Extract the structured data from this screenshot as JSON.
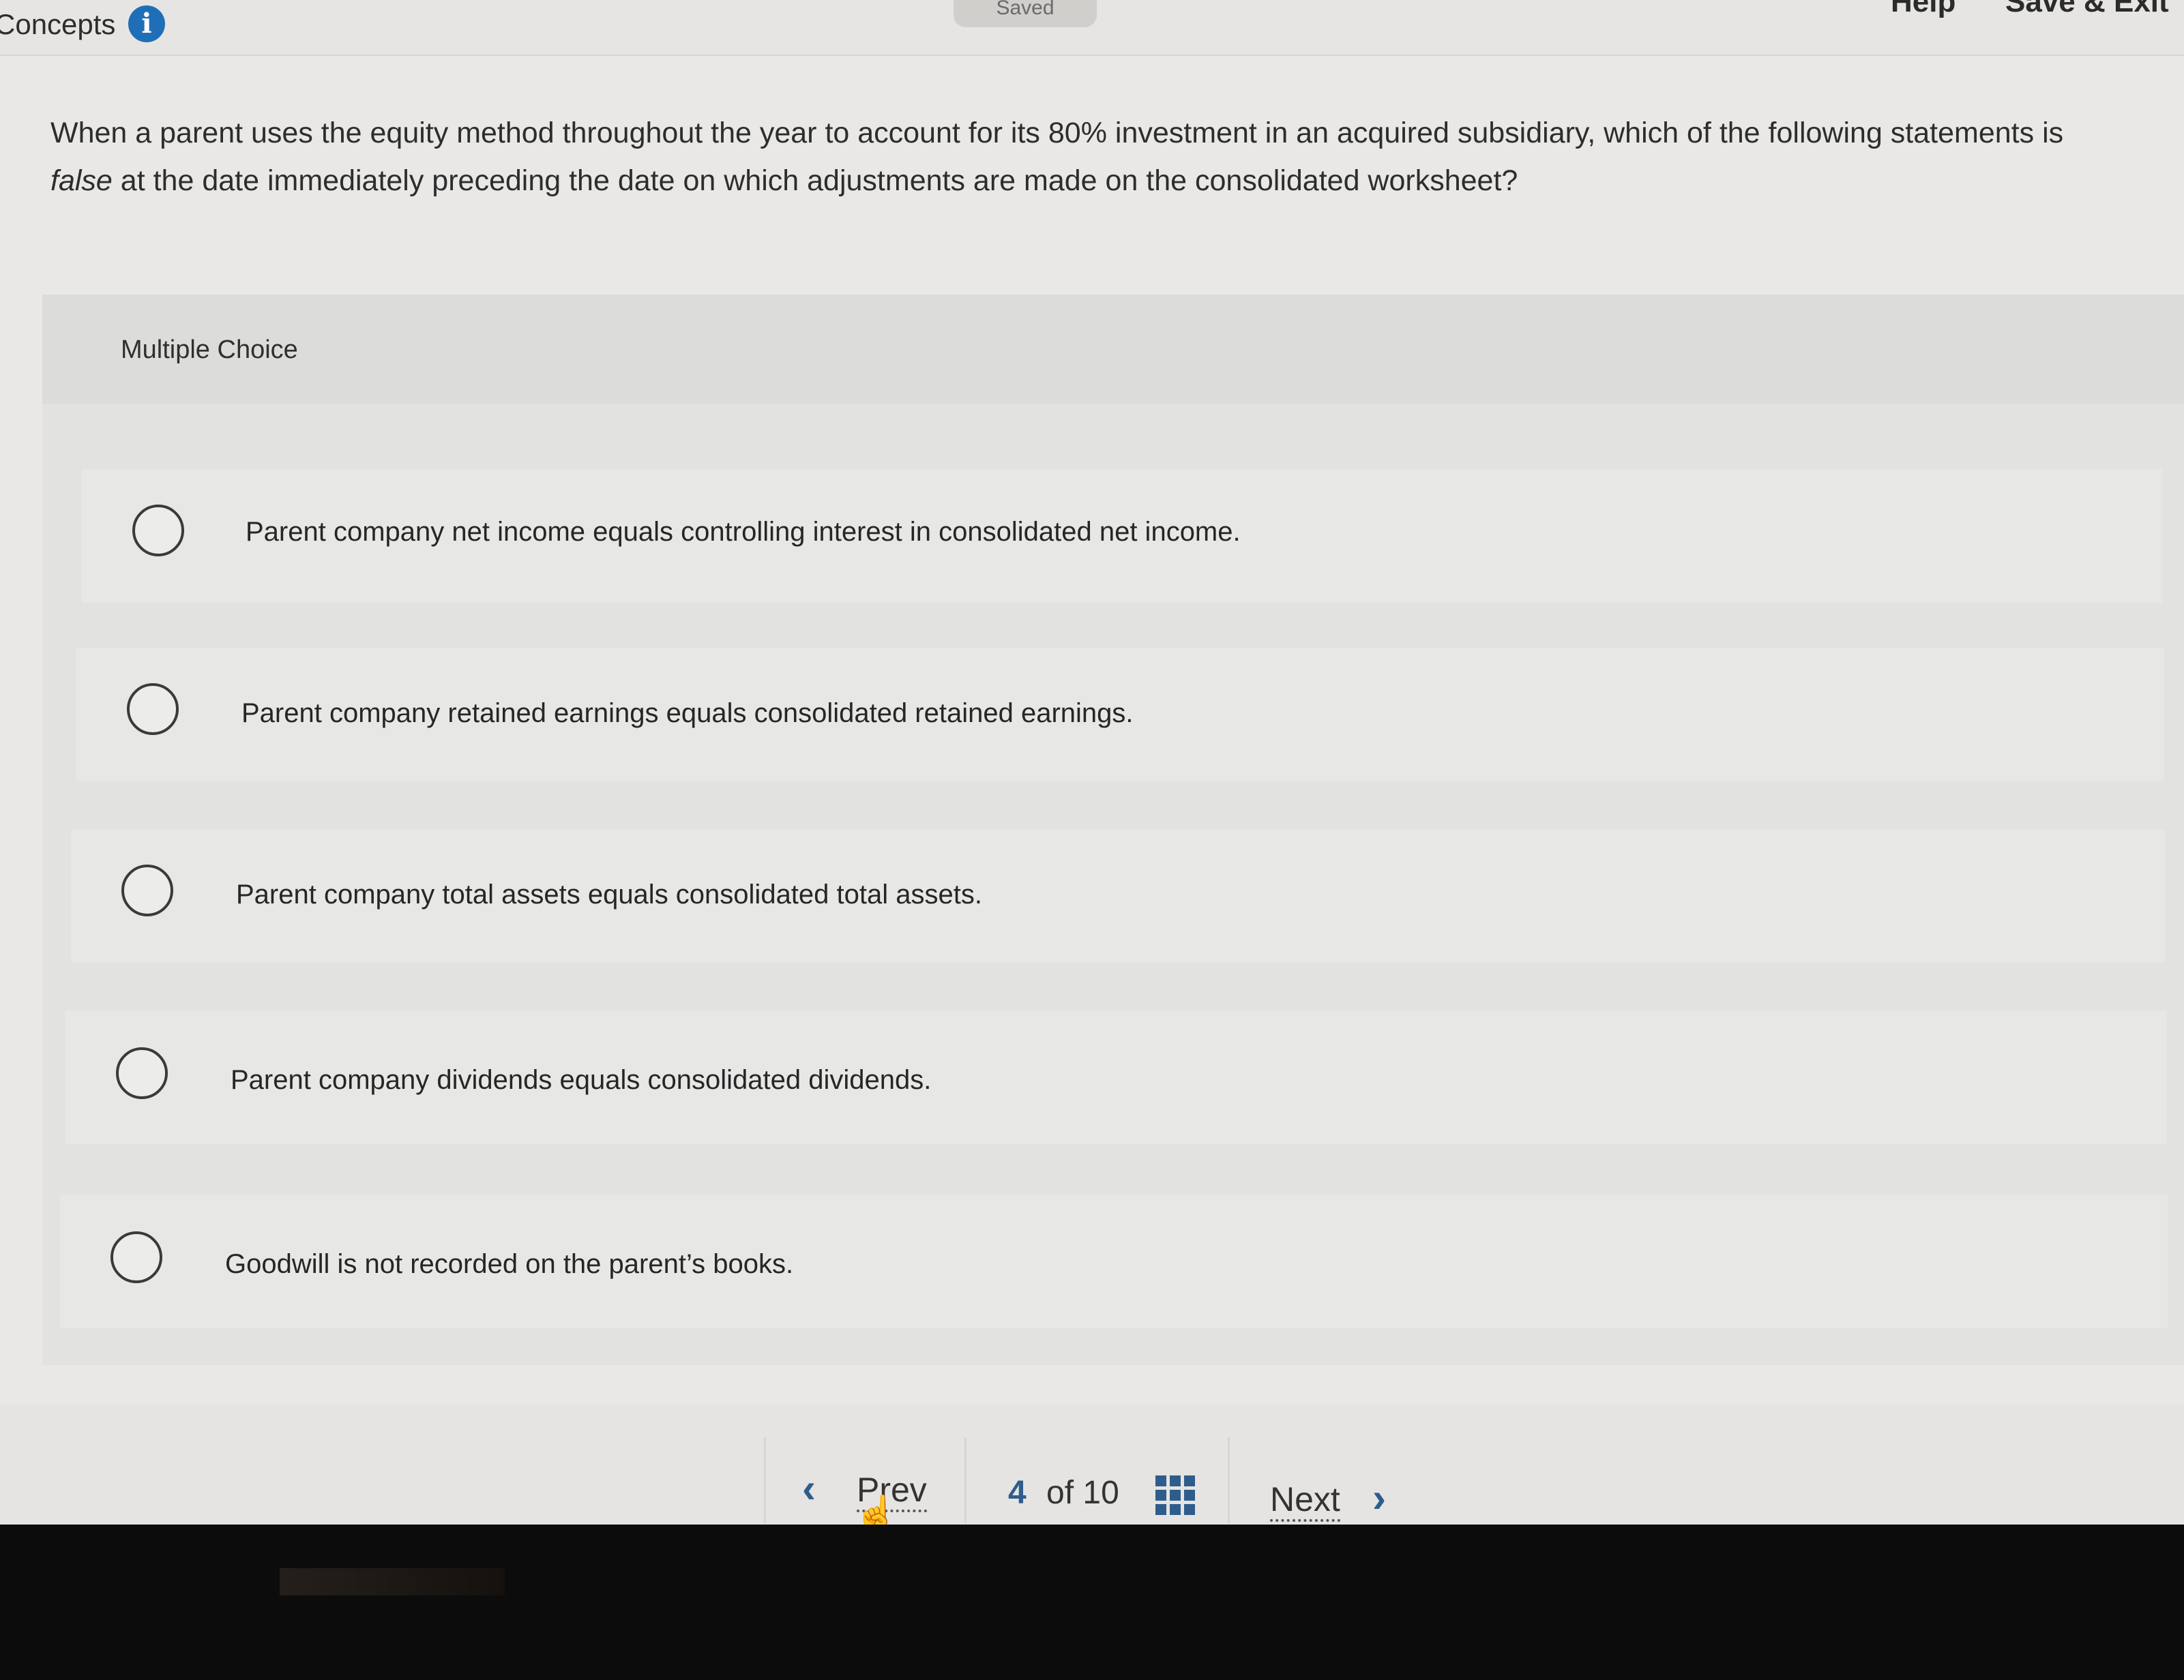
{
  "header": {
    "section_title": "Concepts",
    "info_icon_glyph": "i",
    "saved_status": "Saved",
    "help_label": "Help",
    "save_exit_label": "Save & Exit"
  },
  "question": {
    "text_before": "When a parent uses the equity method throughout the year to account for its 80% investment in an acquired subsidiary, which of the following statements is ",
    "emphasis": "false",
    "text_after": " at the date immediately preceding the date on which adjustments are made on the consolidated worksheet?"
  },
  "multiple_choice": {
    "label": "Multiple Choice",
    "options": [
      "Parent company net income equals controlling interest in consolidated net income.",
      "Parent company retained earnings equals consolidated retained earnings.",
      "Parent company total assets equals consolidated total assets.",
      "Parent company dividends equals consolidated dividends.",
      "Goodwill is not recorded on the parent’s books."
    ]
  },
  "navigation": {
    "prev_icon": "chevron-left",
    "prev_label": "Prev",
    "current_page": "4",
    "page_of_total": "of 10",
    "grid_icon": "grid",
    "next_label": "Next",
    "next_icon": "chevron-right",
    "accent_color": "#2e5d8c"
  },
  "colors": {
    "page_background": "#e9e8e6",
    "info_icon": "#1f6fb8"
  }
}
